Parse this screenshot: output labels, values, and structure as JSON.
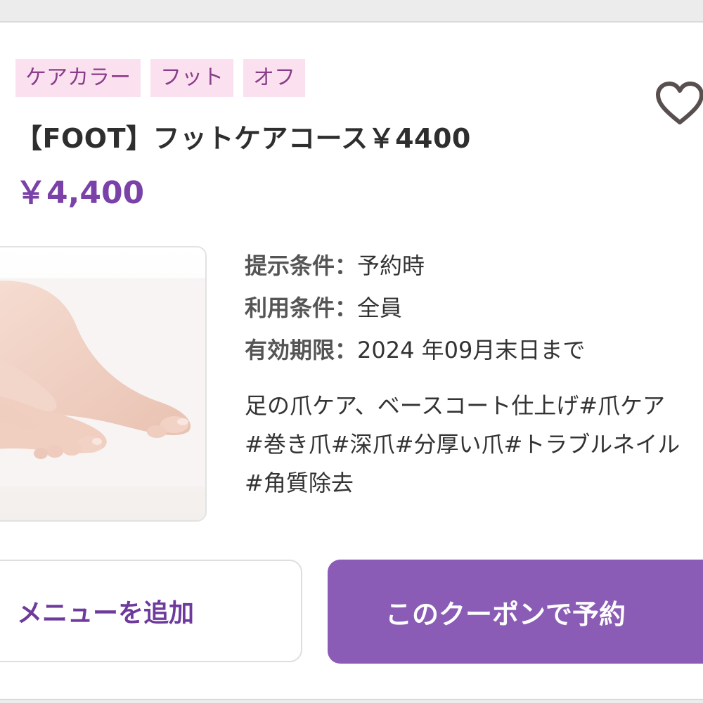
{
  "tags": [
    "ケアカラー",
    "フット",
    "オフ"
  ],
  "coupon": {
    "title": "【FOOT】フットケアコース￥4400",
    "price": "￥4,400"
  },
  "favorite_icon": "heart-outline-icon",
  "image": "bare-feet-photo",
  "conditions": [
    {
      "label": "提示条件：",
      "value": "予約時"
    },
    {
      "label": "利用条件：",
      "value": "全員"
    },
    {
      "label": "有効期限：",
      "value": "2024 年09月末日まで"
    }
  ],
  "description_lines": [
    "足の爪ケア、ベースコート仕上げ#爪ケア",
    "#巻き爪#深爪#分厚い爪#トラブルネイル",
    "#角質除去"
  ],
  "buttons": {
    "add_menu": "メニューを追加",
    "reserve": "このクーポンで予約"
  },
  "colors": {
    "accent": "#7a42a8",
    "button": "#8a5cb5",
    "tag_bg": "#fbe1ef",
    "tag_text": "#8a3d8a"
  }
}
